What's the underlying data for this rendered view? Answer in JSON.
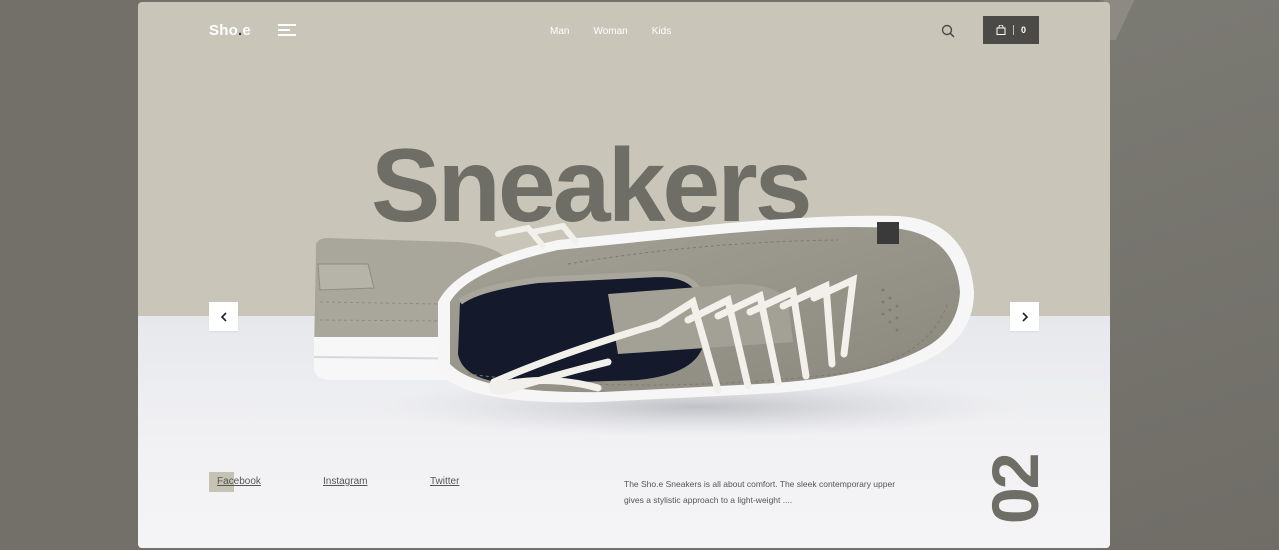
{
  "brand": {
    "logo_main": "Sho",
    "logo_dot": ".",
    "logo_tail": "e"
  },
  "nav": {
    "items": [
      {
        "label": "Man"
      },
      {
        "label": "Woman"
      },
      {
        "label": "Kids"
      }
    ]
  },
  "cart": {
    "count": "0"
  },
  "hero": {
    "headline": "Sneakers",
    "slide_number": "02",
    "description": "The Sho.e Sneakers is all about comfort. The sleek contemporary upper gives a stylistic approach to a light-weight ...."
  },
  "social": {
    "facebook": "Facebook",
    "instagram": "Instagram",
    "twitter": "Twitter"
  },
  "colors": {
    "card_background": "#c9c6b9",
    "headline": "#6f6e66",
    "page_background": "#727068",
    "accent_square": "#3a3a3a"
  },
  "icons": {
    "menu": "hamburger-icon",
    "search": "search-icon",
    "cart": "shopping-bag-icon",
    "prev": "chevron-left-icon",
    "next": "chevron-right-icon"
  }
}
